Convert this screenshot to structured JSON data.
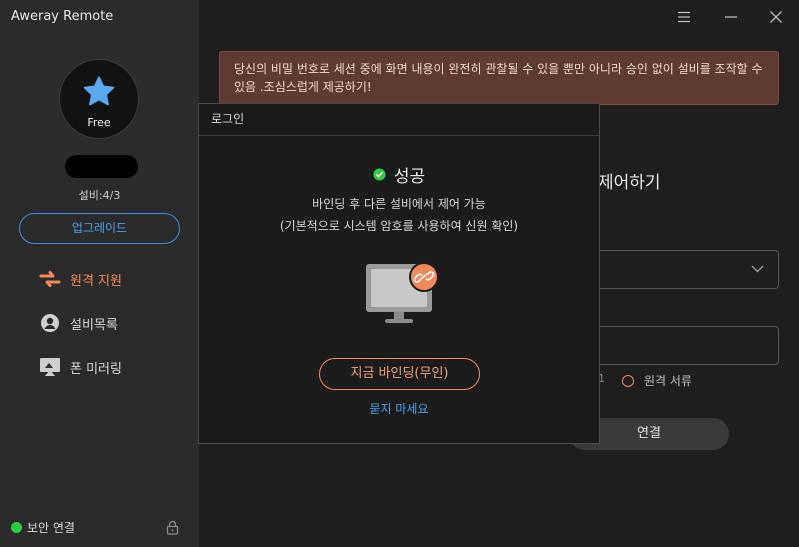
{
  "app": {
    "title": "Aweray Remote"
  },
  "profile": {
    "plan": "Free",
    "device_count": "설비:4/3",
    "upgrade_label": "업그레이드"
  },
  "nav": {
    "items": [
      {
        "label": "원격 지원",
        "icon": "remote-support-icon",
        "active": true
      },
      {
        "label": "설비목록",
        "icon": "device-list-icon",
        "active": false
      },
      {
        "label": "폰 미러링",
        "icon": "phone-mirroring-icon",
        "active": false
      }
    ]
  },
  "status": {
    "secure_label": "보안 연결"
  },
  "main": {
    "warning": "당신의 비밀 번호로 세션 중에 화면 내용이 완전히 관찰될 수 있을 뿐만 아니라 승인 없이 설비를 조작할 수 있음 .조심스럽게 제공하기!",
    "heading_fragment": "제어하기",
    "radio_fragment": "1",
    "radio_label": "원격 서류",
    "connect_label": "연결"
  },
  "modal": {
    "title": "로그인",
    "success": "성공",
    "line1": "바인딩 후 다른 설비에서 제어 가능",
    "line2": "(기본적으로 시스템 암호를 사용하여 신원 확인)",
    "bind_label": "지금 바인딩(무인)",
    "dont_ask_label": "묻지 마세요"
  },
  "colors": {
    "accent": "#f08a5c",
    "link": "#4a9df0",
    "success": "#2ecc40",
    "warning_bg": "#5e3a32"
  }
}
